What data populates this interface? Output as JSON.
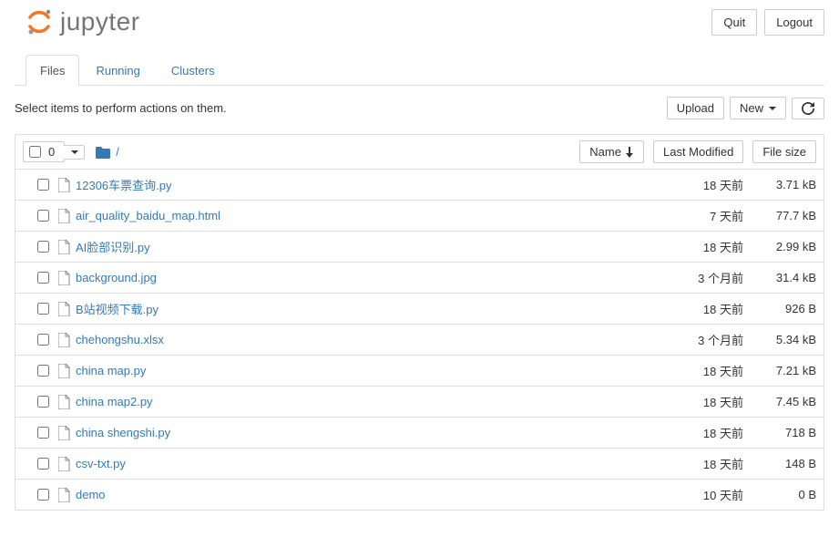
{
  "header": {
    "logo_text": "jupyter",
    "quit_label": "Quit",
    "logout_label": "Logout"
  },
  "tabs": {
    "files": "Files",
    "running": "Running",
    "clusters": "Clusters"
  },
  "toolbar": {
    "help_text": "Select items to perform actions on them.",
    "upload_label": "Upload",
    "new_label": "New"
  },
  "list_header": {
    "select_count": "0",
    "breadcrumb_root": "/",
    "name_label": "Name",
    "modified_label": "Last Modified",
    "size_label": "File size"
  },
  "files": [
    {
      "name": "12306车票查询.py",
      "modified": "18 天前",
      "size": "3.71 kB"
    },
    {
      "name": "air_quality_baidu_map.html",
      "modified": "7 天前",
      "size": "77.7 kB"
    },
    {
      "name": "AI脸部识别.py",
      "modified": "18 天前",
      "size": "2.99 kB"
    },
    {
      "name": "background.jpg",
      "modified": "3 个月前",
      "size": "31.4 kB"
    },
    {
      "name": "B站视频下载.py",
      "modified": "18 天前",
      "size": "926 B"
    },
    {
      "name": "chehongshu.xlsx",
      "modified": "3 个月前",
      "size": "5.34 kB"
    },
    {
      "name": "china map.py",
      "modified": "18 天前",
      "size": "7.21 kB"
    },
    {
      "name": "china map2.py",
      "modified": "18 天前",
      "size": "7.45 kB"
    },
    {
      "name": "china shengshi.py",
      "modified": "18 天前",
      "size": "718 B"
    },
    {
      "name": "csv-txt.py",
      "modified": "18 天前",
      "size": "148 B"
    },
    {
      "name": "demo",
      "modified": "10 天前",
      "size": "0 B"
    }
  ]
}
